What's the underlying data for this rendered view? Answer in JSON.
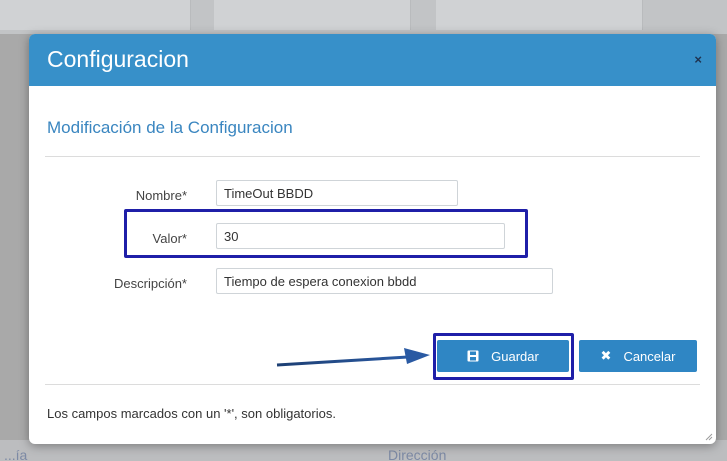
{
  "modal": {
    "title": "Configuracion",
    "close_glyph": "×",
    "section_title": "Modificación de la Configuracion"
  },
  "form": {
    "nombre_label": "Nombre*",
    "nombre_value": "TimeOut BBDD",
    "valor_label": "Valor*",
    "valor_value": "30",
    "descripcion_label": "Descripción*",
    "descripcion_value": "Tiempo de espera conexion bbdd"
  },
  "buttons": {
    "save_label": "Guardar",
    "save_icon": "floppy-disk-icon",
    "cancel_label": "Cancelar",
    "cancel_icon": "close-icon"
  },
  "footer": {
    "note": "Los campos marcados con un '*', son obligatorios."
  },
  "background": {
    "left_text": "...ía",
    "right_text": "Dirección"
  },
  "colors": {
    "header": "#3790c9",
    "button": "#2f86c4",
    "highlight": "#1f1fa8",
    "section_title": "#3a86c0"
  }
}
